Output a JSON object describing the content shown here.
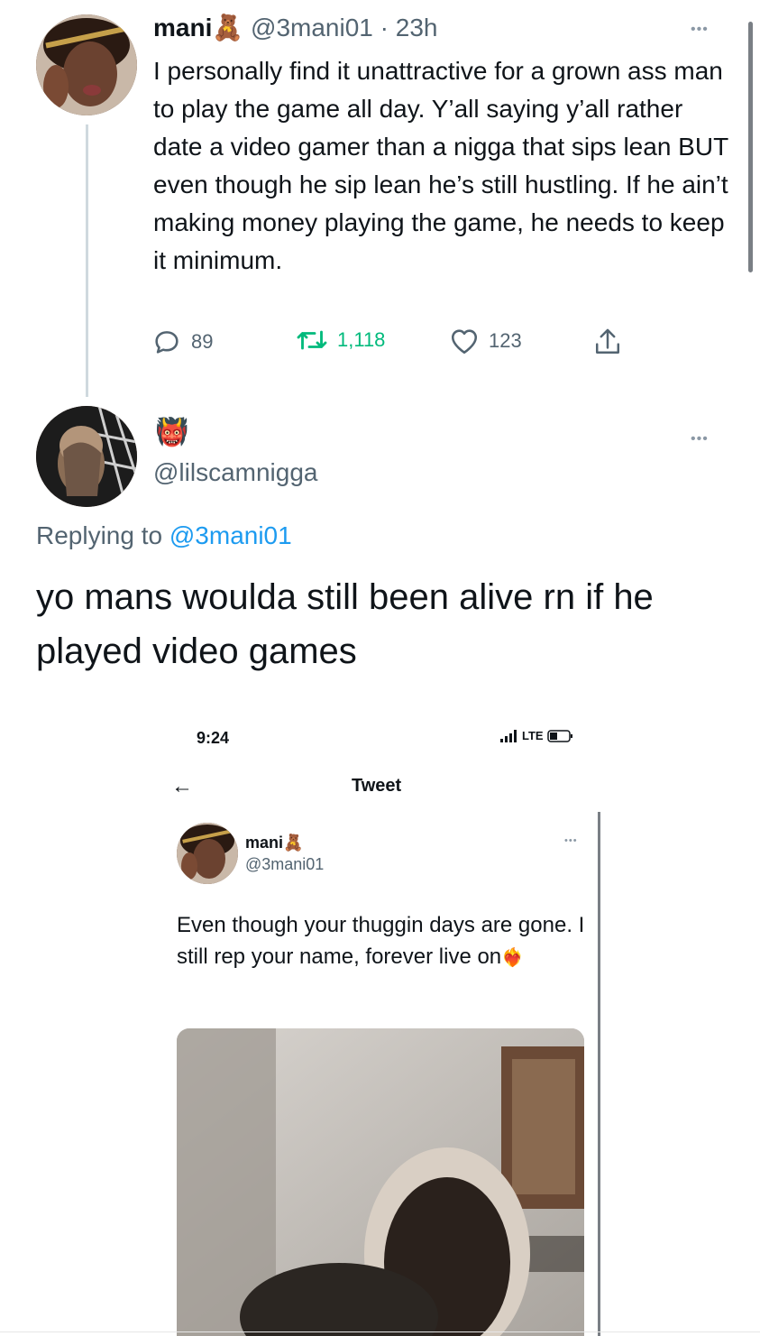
{
  "tweet1": {
    "name": "mani",
    "name_emoji": "🧸",
    "handle": "@3mani01",
    "time": "· 23h",
    "text": "I personally find it unattractive for a grown ass man to play the game all day. Y’all saying y’all rather date a video gamer than a nigga that sips lean BUT even though he sip lean he’s still hustling. If he ain’t making money playing the game, he needs to keep it minimum.",
    "more": "•••",
    "replies": "89",
    "retweets": "1,118",
    "likes": "123",
    "icons": [
      "reply-icon",
      "retweet-icon",
      "like-icon",
      "share-icon"
    ],
    "retweet_color": "#00ba7c"
  },
  "tweet2": {
    "name_emoji": "👹",
    "handle": "@lilscamnigga",
    "more": "•••",
    "replying_prefix": "Replying to",
    "replying_to": "@3mani01",
    "text": "yo mans woulda still been alive rn if he played video games",
    "link_color": "#1d9bf0"
  },
  "embedded": {
    "status_time": "9:24",
    "status_network": "LTE",
    "nav_title": "Tweet",
    "back_icon": "back-arrow-icon",
    "more": "•••",
    "name": "mani",
    "name_emoji": "🧸",
    "handle": "@3mani01",
    "text": "Even though your thuggin days are gone. I still rep your name, forever live on",
    "text_emoji": "❤️‍🔥"
  }
}
